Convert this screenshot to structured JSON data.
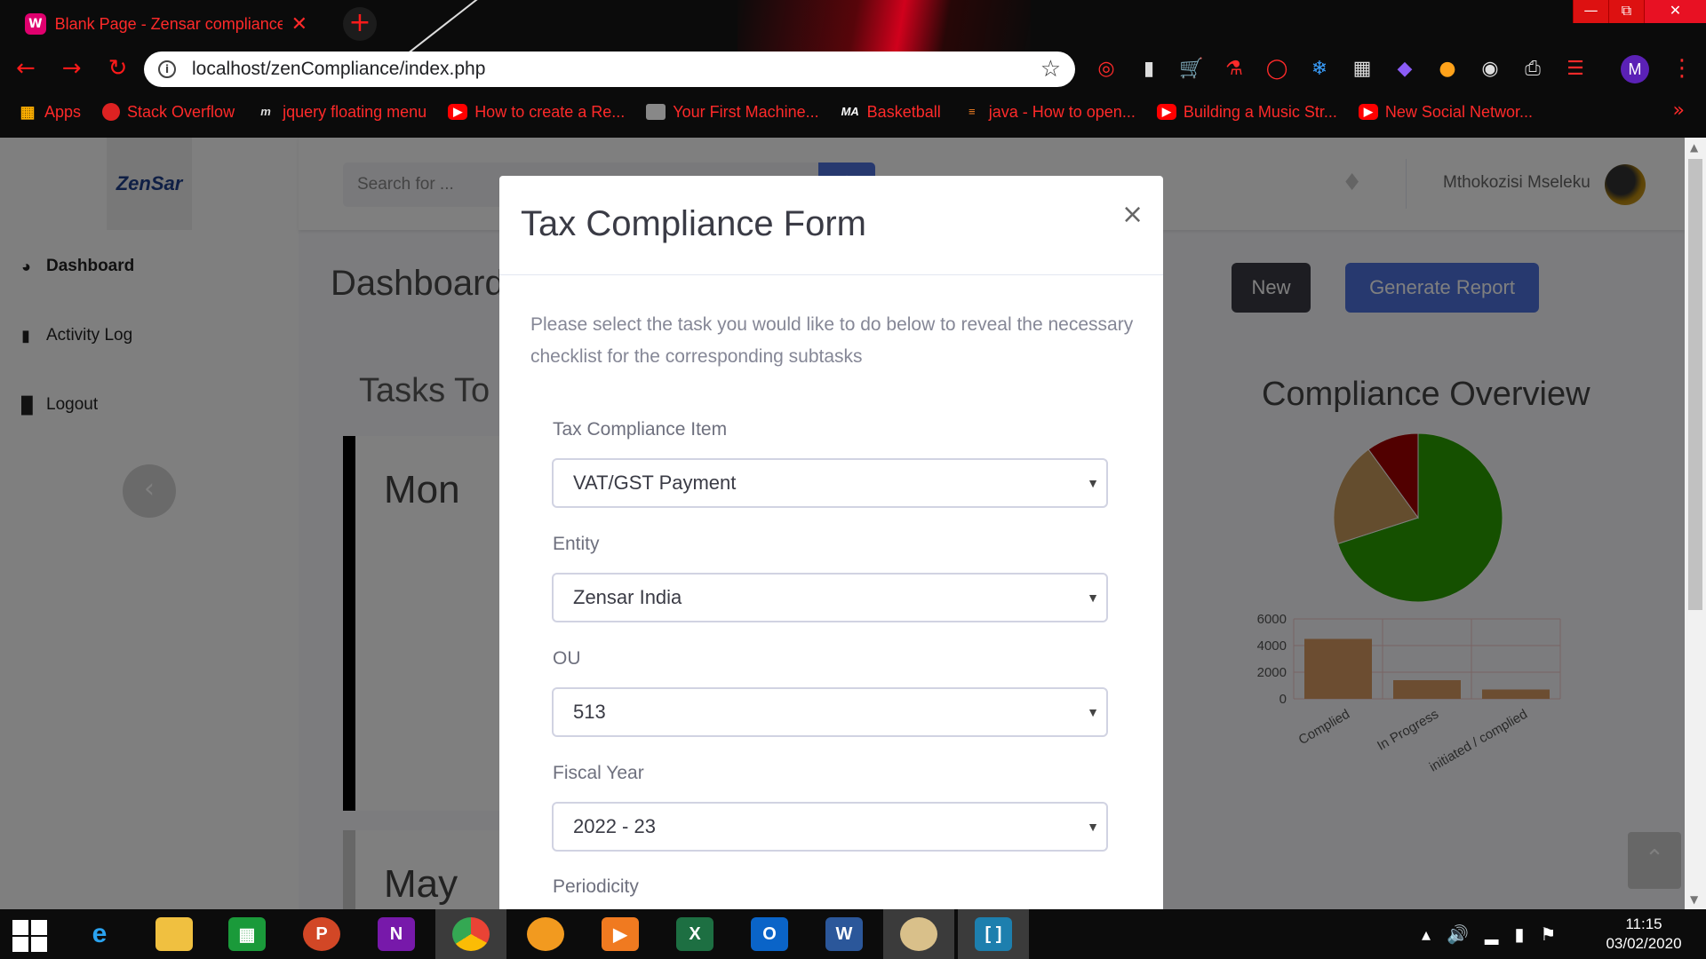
{
  "browser": {
    "tab_title": "Blank Page - Zensar compliance",
    "tab_close": "✕",
    "new_tab": "+",
    "url": "localhost/zenCompliance/index.php",
    "bookmarks": [
      {
        "label": "Apps",
        "icon": "apps-grid-icon"
      },
      {
        "label": "Stack Overflow",
        "icon": "stackoverflow-icon"
      },
      {
        "label": "jquery floating menu",
        "icon": "m-logo-icon"
      },
      {
        "label": "How to create a Re...",
        "icon": "youtube-icon"
      },
      {
        "label": "Your First Machine...",
        "icon": "image-icon"
      },
      {
        "label": "Basketball",
        "icon": "ma-logo-icon"
      },
      {
        "label": "java - How to open...",
        "icon": "stack-icon"
      },
      {
        "label": "Building a Music Str...",
        "icon": "youtube-icon"
      },
      {
        "label": "New Social Networ...",
        "icon": "youtube-icon"
      }
    ],
    "profile_initial": "M"
  },
  "app": {
    "brand": "ZenSar",
    "sidebar": [
      {
        "label": "Dashboard",
        "icon": "dashboard-icon"
      },
      {
        "label": "Activity Log",
        "icon": "book-icon"
      },
      {
        "label": "Logout",
        "icon": "door-icon"
      }
    ],
    "search_placeholder": "Search for ...",
    "user_name": "Mthokozisi Mseleku",
    "page_heading": "Dashboard",
    "btn_new": "New",
    "btn_report": "Generate Report",
    "tasks_heading": "Tasks To",
    "days": [
      "Mon",
      "May"
    ],
    "overview_title": "Compliance Overview"
  },
  "chart_data": [
    {
      "type": "pie",
      "title": "",
      "slices": [
        {
          "value": 70,
          "color": "#2aa000"
        },
        {
          "value": 20,
          "color": "#c89a5c"
        },
        {
          "value": 10,
          "color": "#a30000"
        }
      ]
    },
    {
      "type": "bar",
      "categories": [
        "Complied",
        "In Progress",
        "initiated / complied"
      ],
      "values": [
        4500,
        1400,
        700
      ],
      "yticks": [
        0,
        2000,
        4000,
        6000
      ],
      "ylim": [
        0,
        6000
      ],
      "color": "#d99a62"
    }
  ],
  "modal": {
    "title": "Tax Compliance Form",
    "close": "×",
    "intro": "Please select the task you would like to do below to reveal the necessary checklist for the corresponding subtasks",
    "fields": [
      {
        "label": "Tax Compliance Item",
        "value": "VAT/GST Payment"
      },
      {
        "label": "Entity",
        "value": "Zensar India"
      },
      {
        "label": "OU",
        "value": "513"
      },
      {
        "label": "Fiscal Year",
        "value": "2022 - 23"
      },
      {
        "label": "Periodicity",
        "value": ""
      }
    ]
  },
  "taskbar": {
    "apps": [
      "ie-icon",
      "file-explorer-icon",
      "store-icon",
      "powerpoint-icon",
      "onenote-icon",
      "chrome-icon",
      "fl-studio-icon",
      "media-player-icon",
      "excel-icon",
      "outlook-icon",
      "word-icon",
      "paint-icon",
      "bracket-app-icon"
    ],
    "time": "11:15",
    "date": "03/02/2020"
  }
}
